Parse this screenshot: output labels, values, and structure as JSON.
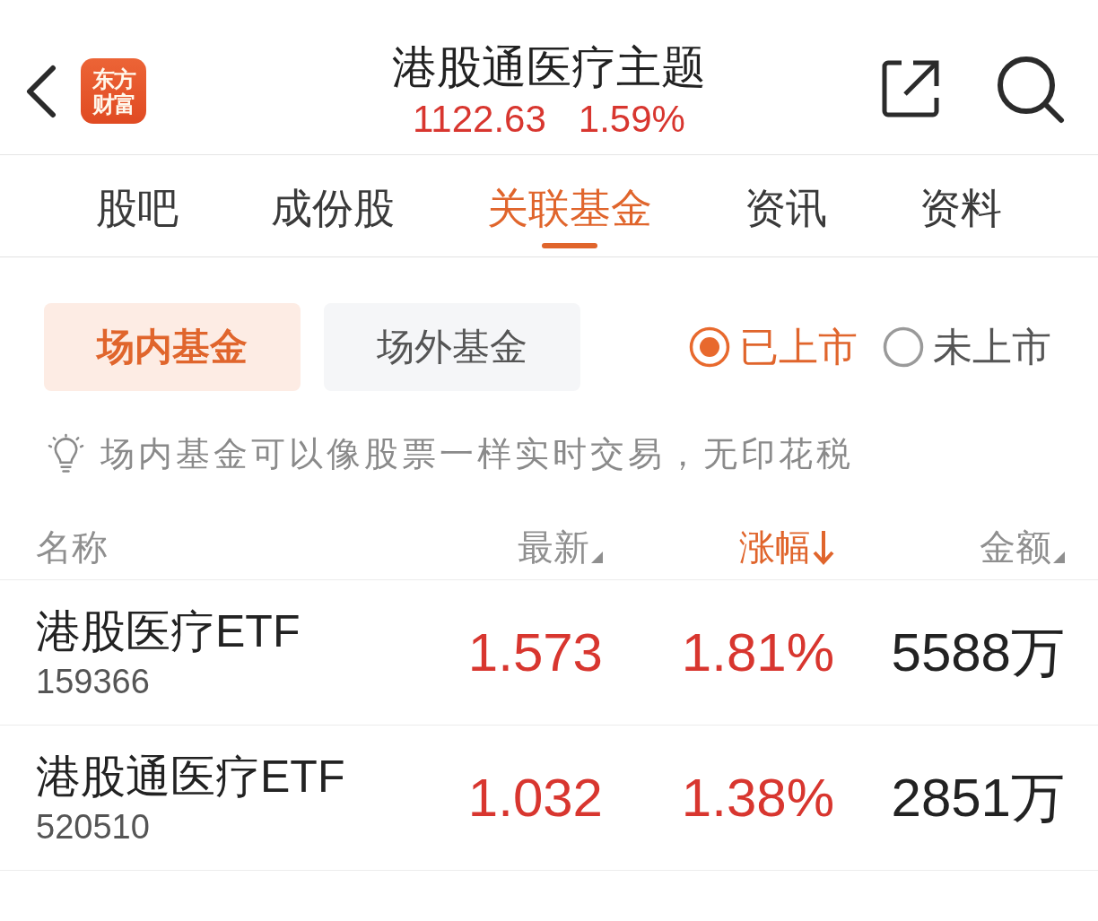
{
  "header": {
    "logo_lines": [
      "东方",
      "财富"
    ],
    "title": "港股通医疗主题",
    "quote": {
      "value": "1122.63",
      "change": "1.59%",
      "rising": true
    }
  },
  "tabs": [
    {
      "label": "股吧",
      "selected": false
    },
    {
      "label": "成份股",
      "selected": false
    },
    {
      "label": "关联基金",
      "selected": true
    },
    {
      "label": "资讯",
      "selected": false
    },
    {
      "label": "资料",
      "selected": false
    }
  ],
  "fund_types": [
    {
      "label": "场内基金",
      "selected": true
    },
    {
      "label": "场外基金",
      "selected": false
    }
  ],
  "listing_filter": [
    {
      "label": "已上市",
      "selected": true
    },
    {
      "label": "未上市",
      "selected": false
    }
  ],
  "tip": "场内基金可以像股票一样实时交易，无印花税",
  "table": {
    "columns": [
      {
        "label": "名称",
        "sortable": false,
        "sorted": false
      },
      {
        "label": "最新",
        "sortable": true,
        "sorted": false
      },
      {
        "label": "涨幅",
        "sortable": true,
        "sorted": true
      },
      {
        "label": "金额",
        "sortable": true,
        "sorted": false
      }
    ],
    "rows": [
      {
        "name": "港股医疗ETF",
        "code": "159366",
        "price": "1.573",
        "change": "1.81%",
        "amount": "5588万",
        "rising": true
      },
      {
        "name": "港股通医疗ETF",
        "code": "520510",
        "price": "1.032",
        "change": "1.38%",
        "amount": "2851万",
        "rising": true
      }
    ]
  }
}
